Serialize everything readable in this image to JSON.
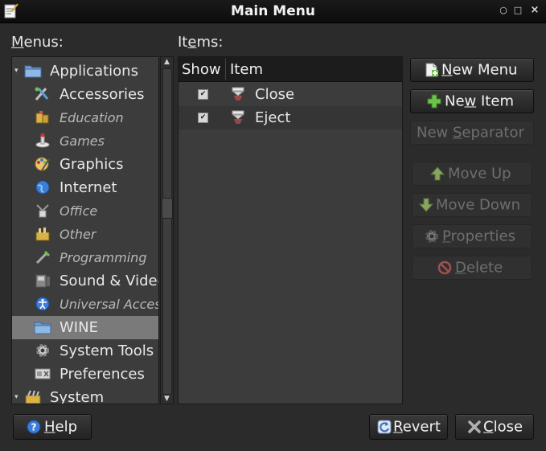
{
  "window": {
    "title": "Main Menu",
    "controls": [
      "minimize",
      "maximize",
      "close"
    ]
  },
  "menus_label": "Menus:",
  "items_label": "Items:",
  "tree": [
    {
      "label": "Applications",
      "icon": "folder-icon",
      "level": 0,
      "expanded": true,
      "enabled": true
    },
    {
      "label": "Accessories",
      "icon": "accessories-icon",
      "level": 1,
      "enabled": true
    },
    {
      "label": "Education",
      "icon": "education-icon",
      "level": 1,
      "enabled": false
    },
    {
      "label": "Games",
      "icon": "games-icon",
      "level": 1,
      "enabled": false
    },
    {
      "label": "Graphics",
      "icon": "graphics-icon",
      "level": 1,
      "enabled": true
    },
    {
      "label": "Internet",
      "icon": "globe-icon",
      "level": 1,
      "enabled": true
    },
    {
      "label": "Office",
      "icon": "office-icon",
      "level": 1,
      "enabled": false
    },
    {
      "label": "Other",
      "icon": "other-icon",
      "level": 1,
      "enabled": false
    },
    {
      "label": "Programming",
      "icon": "programming-icon",
      "level": 1,
      "enabled": false
    },
    {
      "label": "Sound & Video",
      "icon": "multimedia-icon",
      "level": 1,
      "enabled": true
    },
    {
      "label": "Universal Access",
      "icon": "accessibility-icon",
      "level": 1,
      "enabled": false
    },
    {
      "label": "WINE",
      "icon": "folder-icon",
      "level": 1,
      "enabled": true,
      "selected": true
    },
    {
      "label": "System Tools",
      "icon": "gear-icon",
      "level": 1,
      "enabled": true
    },
    {
      "label": "Preferences",
      "icon": "preferences-icon",
      "level": 1,
      "enabled": true
    },
    {
      "label": "System",
      "icon": "system-icon",
      "level": 0,
      "expanded": true,
      "enabled": true
    }
  ],
  "items_table": {
    "columns": [
      "Show",
      "Item"
    ],
    "rows": [
      {
        "show": true,
        "icon": "eject-icon",
        "label": "Close"
      },
      {
        "show": true,
        "icon": "eject-icon",
        "label": "Eject"
      }
    ]
  },
  "buttons": {
    "new_menu": {
      "label": "New Menu",
      "mnemonic": "N",
      "icon": "new-menu-icon",
      "enabled": true
    },
    "new_item": {
      "label": "New Item",
      "mnemonic": "w",
      "icon": "plus-icon",
      "enabled": true
    },
    "new_separator": {
      "label": "New Separator",
      "mnemonic": "S",
      "enabled": false
    },
    "move_up": {
      "label": "Move Up",
      "icon": "arrow-up-icon",
      "enabled": false
    },
    "move_down": {
      "label": "Move Down",
      "icon": "arrow-down-icon",
      "enabled": false
    },
    "properties": {
      "label": "Properties",
      "mnemonic": "P",
      "icon": "gear-icon",
      "enabled": false
    },
    "delete": {
      "label": "Delete",
      "mnemonic": "D",
      "icon": "delete-icon",
      "enabled": false
    },
    "help": {
      "label": "Help",
      "mnemonic": "H",
      "icon": "help-icon"
    },
    "revert": {
      "label": "Revert",
      "mnemonic": "R",
      "icon": "revert-icon"
    },
    "close": {
      "label": "Close",
      "mnemonic": "C",
      "icon": "close-icon"
    }
  },
  "colors": {
    "background": "#2b2b2b",
    "panel": "#3c3c3c",
    "selection": "#7a7a7a",
    "plus_green": "#6cc24a",
    "help_blue": "#3b7dd8"
  }
}
